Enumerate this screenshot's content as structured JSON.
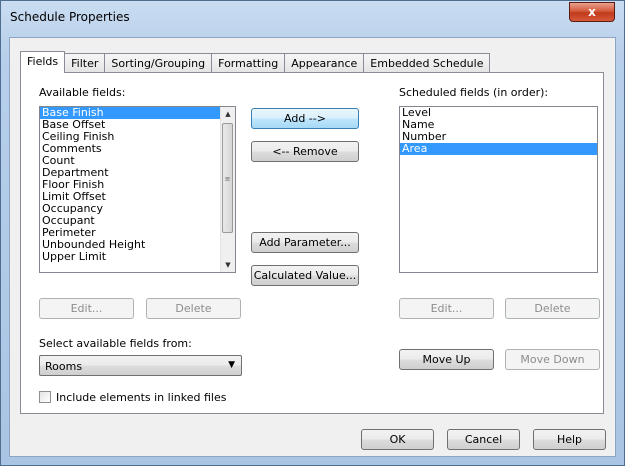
{
  "window": {
    "title": "Schedule Properties",
    "close_glyph": "x"
  },
  "tabs": [
    {
      "label": "Fields",
      "active": true
    },
    {
      "label": "Filter"
    },
    {
      "label": "Sorting/Grouping"
    },
    {
      "label": "Formatting"
    },
    {
      "label": "Appearance"
    },
    {
      "label": "Embedded Schedule"
    }
  ],
  "available": {
    "label": "Available fields:",
    "items": [
      "Base Finish",
      "Base Offset",
      "Ceiling Finish",
      "Comments",
      "Count",
      "Department",
      "Floor Finish",
      "Limit Offset",
      "Occupancy",
      "Occupant",
      "Perimeter",
      "Unbounded Height",
      "Upper Limit"
    ],
    "selected_index": 0,
    "edit_label": "Edit...",
    "delete_label": "Delete"
  },
  "middle": {
    "add_label": "Add -->",
    "remove_label": "<-- Remove",
    "add_parameter_label": "Add Parameter...",
    "calculated_value_label": "Calculated Value..."
  },
  "scheduled": {
    "label": "Scheduled fields (in order):",
    "items": [
      "Level",
      "Name",
      "Number",
      "Area"
    ],
    "selected_index": 3,
    "edit_label": "Edit...",
    "delete_label": "Delete",
    "move_up_label": "Move Up",
    "move_down_label": "Move Down"
  },
  "source": {
    "label": "Select available fields from:",
    "value": "Rooms"
  },
  "linked": {
    "label": "Include elements in linked files",
    "checked": false
  },
  "footer": {
    "ok_label": "OK",
    "cancel_label": "Cancel",
    "help_label": "Help"
  },
  "icons": {
    "scroll_up": "up-arrow-icon",
    "scroll_down": "down-arrow-icon",
    "dropdown": "chevron-down-icon"
  }
}
